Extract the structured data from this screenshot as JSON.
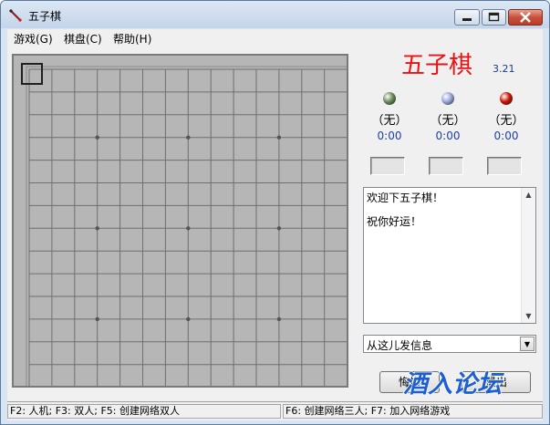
{
  "window": {
    "title": "五子棋"
  },
  "menu": {
    "items": [
      {
        "label": "游戏(G)"
      },
      {
        "label": "棋盘(C)"
      },
      {
        "label": "帮助(H)"
      }
    ]
  },
  "header": {
    "logo": "五子棋",
    "version": "3.21"
  },
  "players": [
    {
      "name": "（无）",
      "time": "0:00",
      "color": "#6a8a5a"
    },
    {
      "name": "（无）",
      "time": "0:00",
      "color": "#9aa6dc"
    },
    {
      "name": "（无）",
      "time": "0:00",
      "color": "#cc1100"
    }
  ],
  "chat": {
    "lines": [
      "欢迎下五子棋！",
      "祝你好运！"
    ]
  },
  "message_select": {
    "value": "从这儿发信息"
  },
  "actions": {
    "left_label": "悔棋",
    "right_label": "退出"
  },
  "watermark": {
    "text": "酒入论坛"
  },
  "status": {
    "left": "F2: 人机; F3: 双人; F5: 创建网络双人",
    "right": "F6: 创建网络三人; F7: 加入网络游戏"
  },
  "board": {
    "size": 15,
    "star_points": [
      [
        3,
        3
      ],
      [
        3,
        7
      ],
      [
        3,
        11
      ],
      [
        7,
        3
      ],
      [
        7,
        7
      ],
      [
        7,
        11
      ],
      [
        11,
        3
      ],
      [
        11,
        7
      ],
      [
        11,
        11
      ]
    ]
  },
  "colors": {
    "logo": "#ee1111",
    "board_line": "#6f6f6f",
    "board_background": "#b6b6b6",
    "watermark": "#1d5fd1"
  }
}
